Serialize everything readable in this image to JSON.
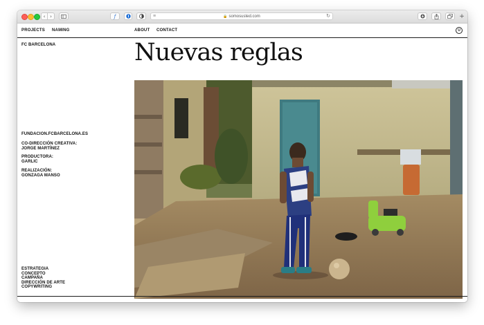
{
  "browser": {
    "url": "somosusted.com",
    "buttons": {
      "back": "‹",
      "forward": "›"
    }
  },
  "nav": {
    "projects": "PROJECTS",
    "naming": "NAMING",
    "about": "ABOUT",
    "contact": "CONTACT"
  },
  "project": {
    "client": "FC BARCELONA",
    "title": "Nuevas reglas",
    "website": "FUNDACION.FCBARCELONA.ES",
    "credits": [
      {
        "role": "CO-DIRECCIÓN CREATIVA:",
        "name": "JORGE MARTÍNEZ"
      },
      {
        "role": "PRODUCTORA:",
        "name": "GARLIC"
      },
      {
        "role": "REALIZACIÓN:",
        "name": "GONZAGA MANSO"
      }
    ],
    "services": [
      "ESTRATEGIA",
      "CONCEPTO",
      "CAMPAÑA",
      "DIRECCIÓN DE ARTE",
      "COPYWRITING"
    ]
  },
  "colors": {
    "text": "#111111",
    "rule": "#1a1a1a",
    "background": "#ffffff"
  }
}
